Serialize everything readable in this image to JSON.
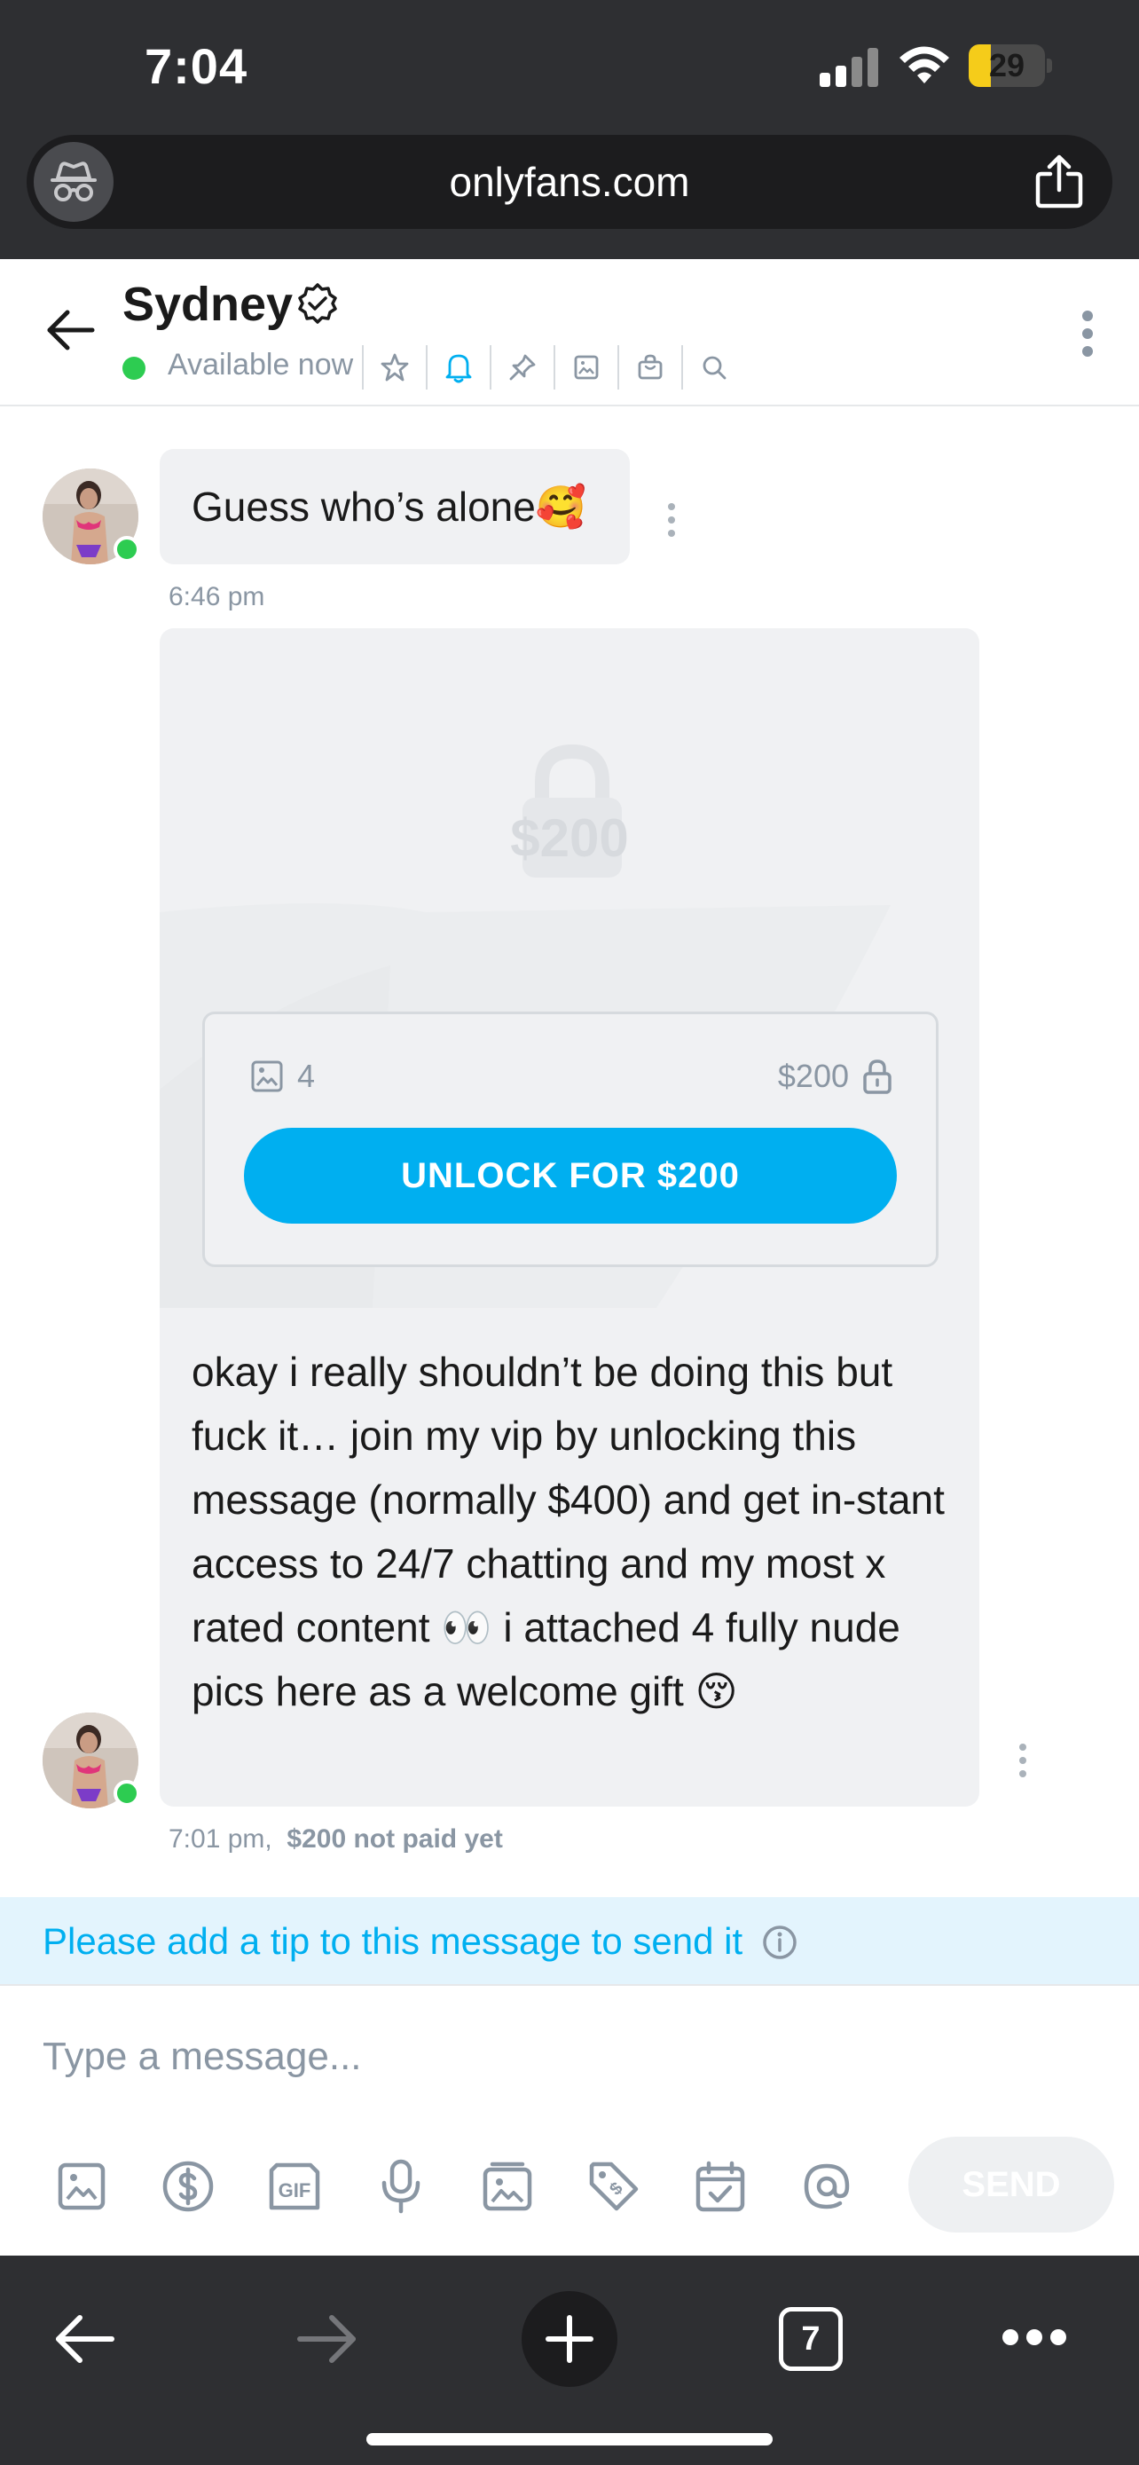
{
  "status_bar": {
    "time": "7:04",
    "battery_percent": "29",
    "battery_level": 0.29,
    "icons": [
      "cellular-signal-icon",
      "wifi-icon",
      "battery-icon"
    ]
  },
  "browser": {
    "url": "onlyfans.com",
    "icons": [
      "incognito-icon",
      "share-icon"
    ],
    "tab_count": "7"
  },
  "chat_header": {
    "name": "Sydney",
    "status": "Available now",
    "icons": [
      "back-arrow-icon",
      "verified-badge-icon",
      "star-icon",
      "bell-icon",
      "pin-icon",
      "image-icon",
      "bag-icon",
      "search-icon",
      "kebab-menu-icon"
    ]
  },
  "messages": [
    {
      "text": "Guess who’s alone🥰",
      "time": "6:46 pm"
    },
    {
      "locked_price": "$200",
      "media_count": "4",
      "price": "$200",
      "unlock_label": "UNLOCK FOR $200",
      "text": "okay i really shouldn’t be doing this but fuck it… join my vip by unlocking this message (normally $400) and get in-stant access to 24/7 chatting and my most x rated content 👀 i attached 4 fully nude pics here as a welcome gift 😚",
      "time": "7:01 pm,",
      "paid_status": "$200 not paid yet"
    }
  ],
  "tip_notice": "Please add a tip to this message to send it",
  "composer": {
    "placeholder": "Type a message...",
    "send_label": "SEND",
    "tools": [
      "image-icon",
      "dollar-icon",
      "gif-icon",
      "microphone-icon",
      "media-vault-icon",
      "price-tag-icon",
      "schedule-icon",
      "mention-icon"
    ]
  },
  "colors": {
    "accent": "#00aff0",
    "online": "#2dcc51",
    "bubble": "#f0f1f3",
    "muted_text": "#8a96a3",
    "chrome": "#2e2f32"
  }
}
